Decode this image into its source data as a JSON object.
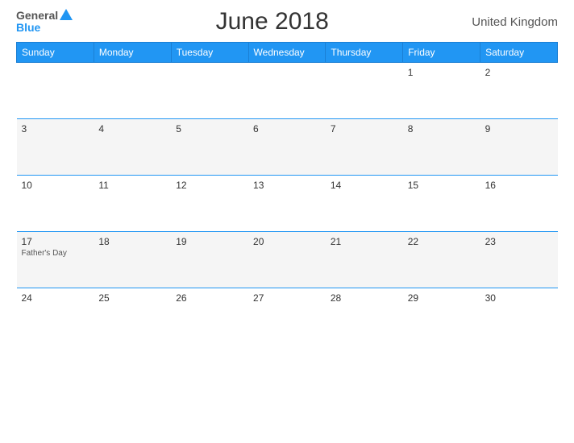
{
  "header": {
    "logo": {
      "general": "General",
      "blue": "Blue"
    },
    "title": "June 2018",
    "country": "United Kingdom"
  },
  "calendar": {
    "days_of_week": [
      "Sunday",
      "Monday",
      "Tuesday",
      "Wednesday",
      "Thursday",
      "Friday",
      "Saturday"
    ],
    "weeks": [
      [
        {
          "date": "",
          "holiday": ""
        },
        {
          "date": "",
          "holiday": ""
        },
        {
          "date": "",
          "holiday": ""
        },
        {
          "date": "",
          "holiday": ""
        },
        {
          "date": "",
          "holiday": ""
        },
        {
          "date": "1",
          "holiday": ""
        },
        {
          "date": "2",
          "holiday": ""
        }
      ],
      [
        {
          "date": "3",
          "holiday": ""
        },
        {
          "date": "4",
          "holiday": ""
        },
        {
          "date": "5",
          "holiday": ""
        },
        {
          "date": "6",
          "holiday": ""
        },
        {
          "date": "7",
          "holiday": ""
        },
        {
          "date": "8",
          "holiday": ""
        },
        {
          "date": "9",
          "holiday": ""
        }
      ],
      [
        {
          "date": "10",
          "holiday": ""
        },
        {
          "date": "11",
          "holiday": ""
        },
        {
          "date": "12",
          "holiday": ""
        },
        {
          "date": "13",
          "holiday": ""
        },
        {
          "date": "14",
          "holiday": ""
        },
        {
          "date": "15",
          "holiday": ""
        },
        {
          "date": "16",
          "holiday": ""
        }
      ],
      [
        {
          "date": "17",
          "holiday": "Father's Day"
        },
        {
          "date": "18",
          "holiday": ""
        },
        {
          "date": "19",
          "holiday": ""
        },
        {
          "date": "20",
          "holiday": ""
        },
        {
          "date": "21",
          "holiday": ""
        },
        {
          "date": "22",
          "holiday": ""
        },
        {
          "date": "23",
          "holiday": ""
        }
      ],
      [
        {
          "date": "24",
          "holiday": ""
        },
        {
          "date": "25",
          "holiday": ""
        },
        {
          "date": "26",
          "holiday": ""
        },
        {
          "date": "27",
          "holiday": ""
        },
        {
          "date": "28",
          "holiday": ""
        },
        {
          "date": "29",
          "holiday": ""
        },
        {
          "date": "30",
          "holiday": ""
        }
      ]
    ]
  }
}
